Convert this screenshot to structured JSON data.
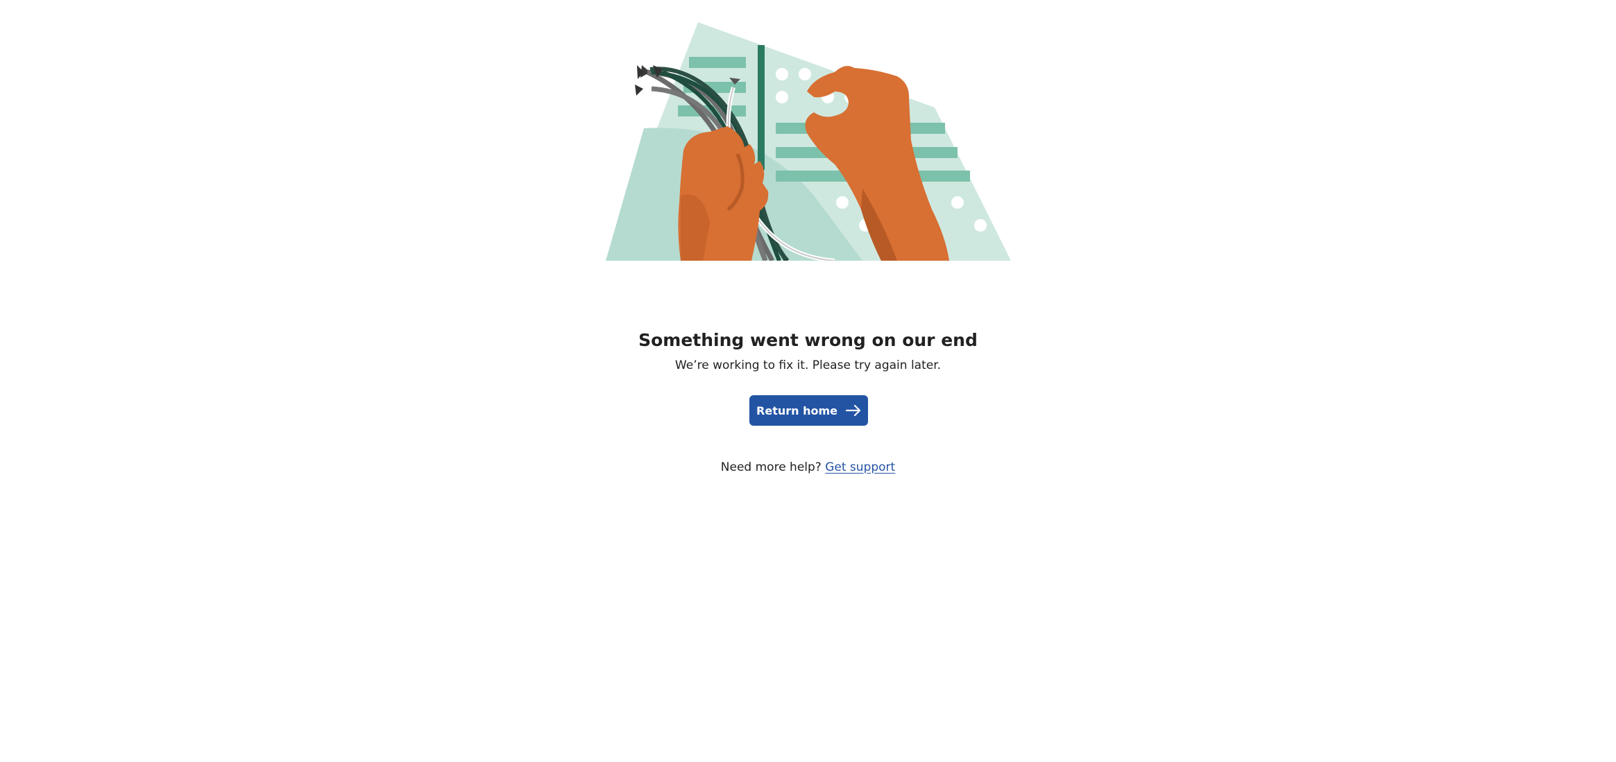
{
  "error": {
    "title": "Something went wrong on our end",
    "message": "We’re working to fix it. Please try again later."
  },
  "actions": {
    "return_home_label": "Return home",
    "return_home_icon": "arrow-right-icon"
  },
  "help": {
    "prompt": "Need more help?",
    "link_label": "Get support"
  },
  "illustration": {
    "subject": "broken-cable-illustration",
    "colors": {
      "panel_light": "#cfe8df",
      "panel_mid": "#b5dbd0",
      "stripe": "#7cc1ab",
      "dark_green": "#2b7a62",
      "hand": "#d86f33",
      "hand_shadow": "#b85a25"
    }
  },
  "colors": {
    "button_bg": "#2354a4",
    "link": "#2354a4",
    "text": "#212121"
  }
}
